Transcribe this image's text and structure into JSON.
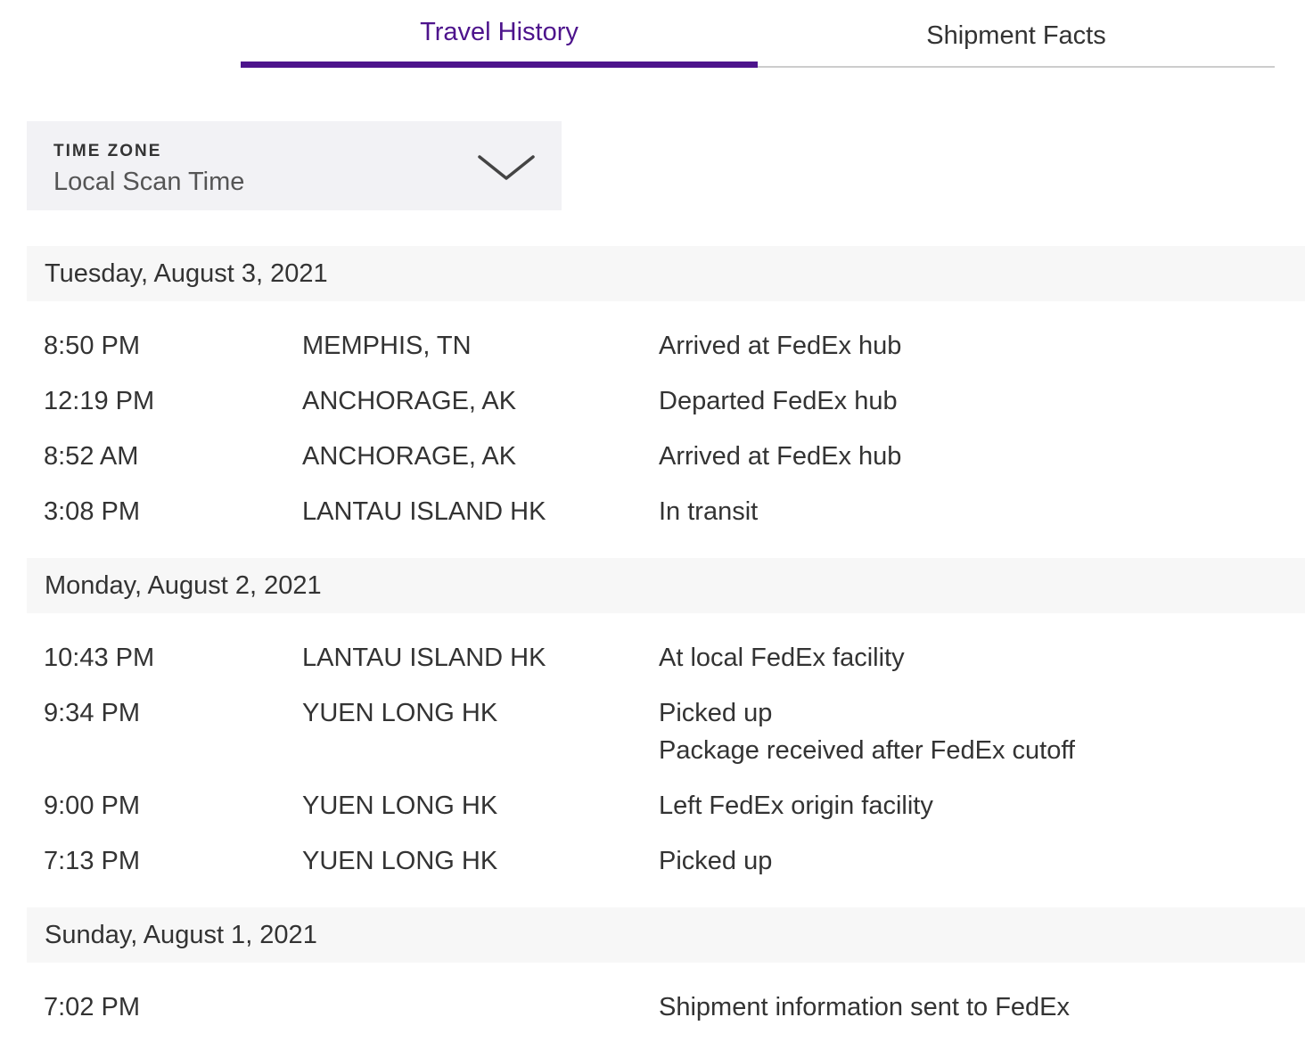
{
  "tabs": [
    {
      "label": "Travel History",
      "active": true
    },
    {
      "label": "Shipment Facts",
      "active": false
    }
  ],
  "colors": {
    "brand_purple": "#4d148c",
    "header_bg": "#f7f7f7",
    "select_bg": "#f2f2f5"
  },
  "time_zone": {
    "label": "TIME ZONE",
    "value": "Local Scan Time",
    "icon": "chevron-down-icon"
  },
  "groups": [
    {
      "date": "Tuesday, August 3, 2021",
      "events": [
        {
          "time": "8:50 PM",
          "location": "MEMPHIS, TN",
          "status": [
            "Arrived at FedEx hub"
          ]
        },
        {
          "time": "12:19 PM",
          "location": "ANCHORAGE, AK",
          "status": [
            "Departed FedEx hub"
          ]
        },
        {
          "time": "8:52 AM",
          "location": "ANCHORAGE, AK",
          "status": [
            "Arrived at FedEx hub"
          ]
        },
        {
          "time": "3:08 PM",
          "location": "LANTAU ISLAND HK",
          "status": [
            "In transit"
          ]
        }
      ]
    },
    {
      "date": "Monday, August 2, 2021",
      "events": [
        {
          "time": "10:43 PM",
          "location": "LANTAU ISLAND HK",
          "status": [
            "At local FedEx facility"
          ]
        },
        {
          "time": "9:34 PM",
          "location": "YUEN LONG HK",
          "status": [
            "Picked up",
            "Package received after FedEx cutoff"
          ]
        },
        {
          "time": "9:00 PM",
          "location": "YUEN LONG HK",
          "status": [
            "Left FedEx origin facility"
          ]
        },
        {
          "time": "7:13 PM",
          "location": "YUEN LONG HK",
          "status": [
            "Picked up"
          ]
        }
      ]
    },
    {
      "date": "Sunday, August 1, 2021",
      "events": [
        {
          "time": "7:02 PM",
          "location": "",
          "status": [
            "Shipment information sent to FedEx"
          ]
        }
      ]
    }
  ]
}
